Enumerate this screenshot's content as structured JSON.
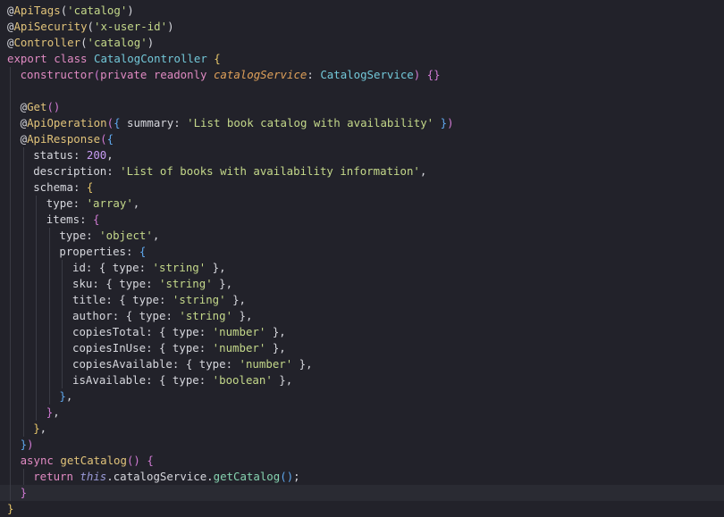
{
  "editor": {
    "current_line": 31,
    "lines": [
      {
        "indent": 0,
        "tokens": [
          [
            "@",
            "deco"
          ],
          [
            "ApiTags",
            "fn"
          ],
          [
            "(",
            "punc"
          ],
          [
            "'catalog'",
            "str"
          ],
          [
            ")",
            "punc"
          ]
        ]
      },
      {
        "indent": 0,
        "tokens": [
          [
            "@",
            "deco"
          ],
          [
            "ApiSecurity",
            "fn"
          ],
          [
            "(",
            "punc"
          ],
          [
            "'x-user-id'",
            "str"
          ],
          [
            ")",
            "punc"
          ]
        ]
      },
      {
        "indent": 0,
        "tokens": [
          [
            "@",
            "deco"
          ],
          [
            "Controller",
            "fn"
          ],
          [
            "(",
            "punc"
          ],
          [
            "'catalog'",
            "str"
          ],
          [
            ")",
            "punc"
          ]
        ]
      },
      {
        "indent": 0,
        "tokens": [
          [
            "export ",
            "kw"
          ],
          [
            "class ",
            "kw"
          ],
          [
            "CatalogController ",
            "cls"
          ],
          [
            "{",
            "brace1"
          ]
        ]
      },
      {
        "indent": 1,
        "tokens": [
          [
            "constructor",
            "kw"
          ],
          [
            "(",
            "brace2"
          ],
          [
            "private ",
            "kw"
          ],
          [
            "readonly ",
            "kw"
          ],
          [
            "catalogService",
            "param"
          ],
          [
            ": ",
            "punc"
          ],
          [
            "CatalogService",
            "cls"
          ],
          [
            ") ",
            "brace2"
          ],
          [
            "{}",
            "brace2"
          ]
        ]
      },
      {
        "indent": 1,
        "tokens": []
      },
      {
        "indent": 1,
        "tokens": [
          [
            "@",
            "deco"
          ],
          [
            "Get",
            "fn"
          ],
          [
            "()",
            "brace2"
          ]
        ]
      },
      {
        "indent": 1,
        "tokens": [
          [
            "@",
            "deco"
          ],
          [
            "ApiOperation",
            "fn"
          ],
          [
            "(",
            "brace2"
          ],
          [
            "{ ",
            "brace3"
          ],
          [
            "summary",
            "prop"
          ],
          [
            ": ",
            "punc"
          ],
          [
            "'List book catalog with availability'",
            "str"
          ],
          [
            " }",
            "brace3"
          ],
          [
            ")",
            "brace2"
          ]
        ]
      },
      {
        "indent": 1,
        "tokens": [
          [
            "@",
            "deco"
          ],
          [
            "ApiResponse",
            "fn"
          ],
          [
            "(",
            "brace2"
          ],
          [
            "{",
            "brace3"
          ]
        ]
      },
      {
        "indent": 2,
        "tokens": [
          [
            "status",
            "prop"
          ],
          [
            ": ",
            "punc"
          ],
          [
            "200",
            "num"
          ],
          [
            ",",
            "punc"
          ]
        ]
      },
      {
        "indent": 2,
        "tokens": [
          [
            "description",
            "prop"
          ],
          [
            ": ",
            "punc"
          ],
          [
            "'List of books with availability information'",
            "str"
          ],
          [
            ",",
            "punc"
          ]
        ]
      },
      {
        "indent": 2,
        "tokens": [
          [
            "schema",
            "prop"
          ],
          [
            ": ",
            "punc"
          ],
          [
            "{",
            "brace1"
          ]
        ]
      },
      {
        "indent": 3,
        "tokens": [
          [
            "type",
            "prop"
          ],
          [
            ": ",
            "punc"
          ],
          [
            "'array'",
            "str"
          ],
          [
            ",",
            "punc"
          ]
        ]
      },
      {
        "indent": 3,
        "tokens": [
          [
            "items",
            "prop"
          ],
          [
            ": ",
            "punc"
          ],
          [
            "{",
            "brace2"
          ]
        ]
      },
      {
        "indent": 4,
        "tokens": [
          [
            "type",
            "prop"
          ],
          [
            ": ",
            "punc"
          ],
          [
            "'object'",
            "str"
          ],
          [
            ",",
            "punc"
          ]
        ]
      },
      {
        "indent": 4,
        "tokens": [
          [
            "properties",
            "prop"
          ],
          [
            ": ",
            "punc"
          ],
          [
            "{",
            "brace3"
          ]
        ]
      },
      {
        "indent": 5,
        "tokens": [
          [
            "id",
            "prop"
          ],
          [
            ": ",
            "punc"
          ],
          [
            "{ ",
            "punc"
          ],
          [
            "type",
            "prop"
          ],
          [
            ": ",
            "punc"
          ],
          [
            "'string'",
            "str"
          ],
          [
            " },",
            "punc"
          ]
        ]
      },
      {
        "indent": 5,
        "tokens": [
          [
            "sku",
            "prop"
          ],
          [
            ": ",
            "punc"
          ],
          [
            "{ ",
            "punc"
          ],
          [
            "type",
            "prop"
          ],
          [
            ": ",
            "punc"
          ],
          [
            "'string'",
            "str"
          ],
          [
            " },",
            "punc"
          ]
        ]
      },
      {
        "indent": 5,
        "tokens": [
          [
            "title",
            "prop"
          ],
          [
            ": ",
            "punc"
          ],
          [
            "{ ",
            "punc"
          ],
          [
            "type",
            "prop"
          ],
          [
            ": ",
            "punc"
          ],
          [
            "'string'",
            "str"
          ],
          [
            " },",
            "punc"
          ]
        ]
      },
      {
        "indent": 5,
        "tokens": [
          [
            "author",
            "prop"
          ],
          [
            ": ",
            "punc"
          ],
          [
            "{ ",
            "punc"
          ],
          [
            "type",
            "prop"
          ],
          [
            ": ",
            "punc"
          ],
          [
            "'string'",
            "str"
          ],
          [
            " },",
            "punc"
          ]
        ]
      },
      {
        "indent": 5,
        "tokens": [
          [
            "copiesTotal",
            "prop"
          ],
          [
            ": ",
            "punc"
          ],
          [
            "{ ",
            "punc"
          ],
          [
            "type",
            "prop"
          ],
          [
            ": ",
            "punc"
          ],
          [
            "'number'",
            "str"
          ],
          [
            " },",
            "punc"
          ]
        ]
      },
      {
        "indent": 5,
        "tokens": [
          [
            "copiesInUse",
            "prop"
          ],
          [
            ": ",
            "punc"
          ],
          [
            "{ ",
            "punc"
          ],
          [
            "type",
            "prop"
          ],
          [
            ": ",
            "punc"
          ],
          [
            "'number'",
            "str"
          ],
          [
            " },",
            "punc"
          ]
        ]
      },
      {
        "indent": 5,
        "tokens": [
          [
            "copiesAvailable",
            "prop"
          ],
          [
            ": ",
            "punc"
          ],
          [
            "{ ",
            "punc"
          ],
          [
            "type",
            "prop"
          ],
          [
            ": ",
            "punc"
          ],
          [
            "'number'",
            "str"
          ],
          [
            " },",
            "punc"
          ]
        ]
      },
      {
        "indent": 5,
        "tokens": [
          [
            "isAvailable",
            "prop"
          ],
          [
            ": ",
            "punc"
          ],
          [
            "{ ",
            "punc"
          ],
          [
            "type",
            "prop"
          ],
          [
            ": ",
            "punc"
          ],
          [
            "'boolean'",
            "str"
          ],
          [
            " },",
            "punc"
          ]
        ]
      },
      {
        "indent": 4,
        "tokens": [
          [
            "}",
            "brace3"
          ],
          [
            ",",
            "punc"
          ]
        ]
      },
      {
        "indent": 3,
        "tokens": [
          [
            "}",
            "brace2"
          ],
          [
            ",",
            "punc"
          ]
        ]
      },
      {
        "indent": 2,
        "tokens": [
          [
            "}",
            "brace1"
          ],
          [
            ",",
            "punc"
          ]
        ]
      },
      {
        "indent": 1,
        "tokens": [
          [
            "}",
            "brace3"
          ],
          [
            ")",
            "brace2"
          ]
        ]
      },
      {
        "indent": 1,
        "tokens": [
          [
            "async ",
            "kw"
          ],
          [
            "getCatalog",
            "fn"
          ],
          [
            "() ",
            "brace2"
          ],
          [
            "{",
            "brace2"
          ]
        ]
      },
      {
        "indent": 2,
        "tokens": [
          [
            "return ",
            "kw"
          ],
          [
            "this",
            "this"
          ],
          [
            ".",
            "punc"
          ],
          [
            "catalogService",
            "prop"
          ],
          [
            ".",
            "punc"
          ],
          [
            "getCatalog",
            "meth"
          ],
          [
            "()",
            "brace3"
          ],
          [
            ";",
            "punc"
          ]
        ]
      },
      {
        "indent": 1,
        "tokens": [
          [
            "}",
            "brace2"
          ]
        ]
      },
      {
        "indent": 0,
        "tokens": [
          [
            "}",
            "brace1"
          ]
        ]
      }
    ]
  }
}
